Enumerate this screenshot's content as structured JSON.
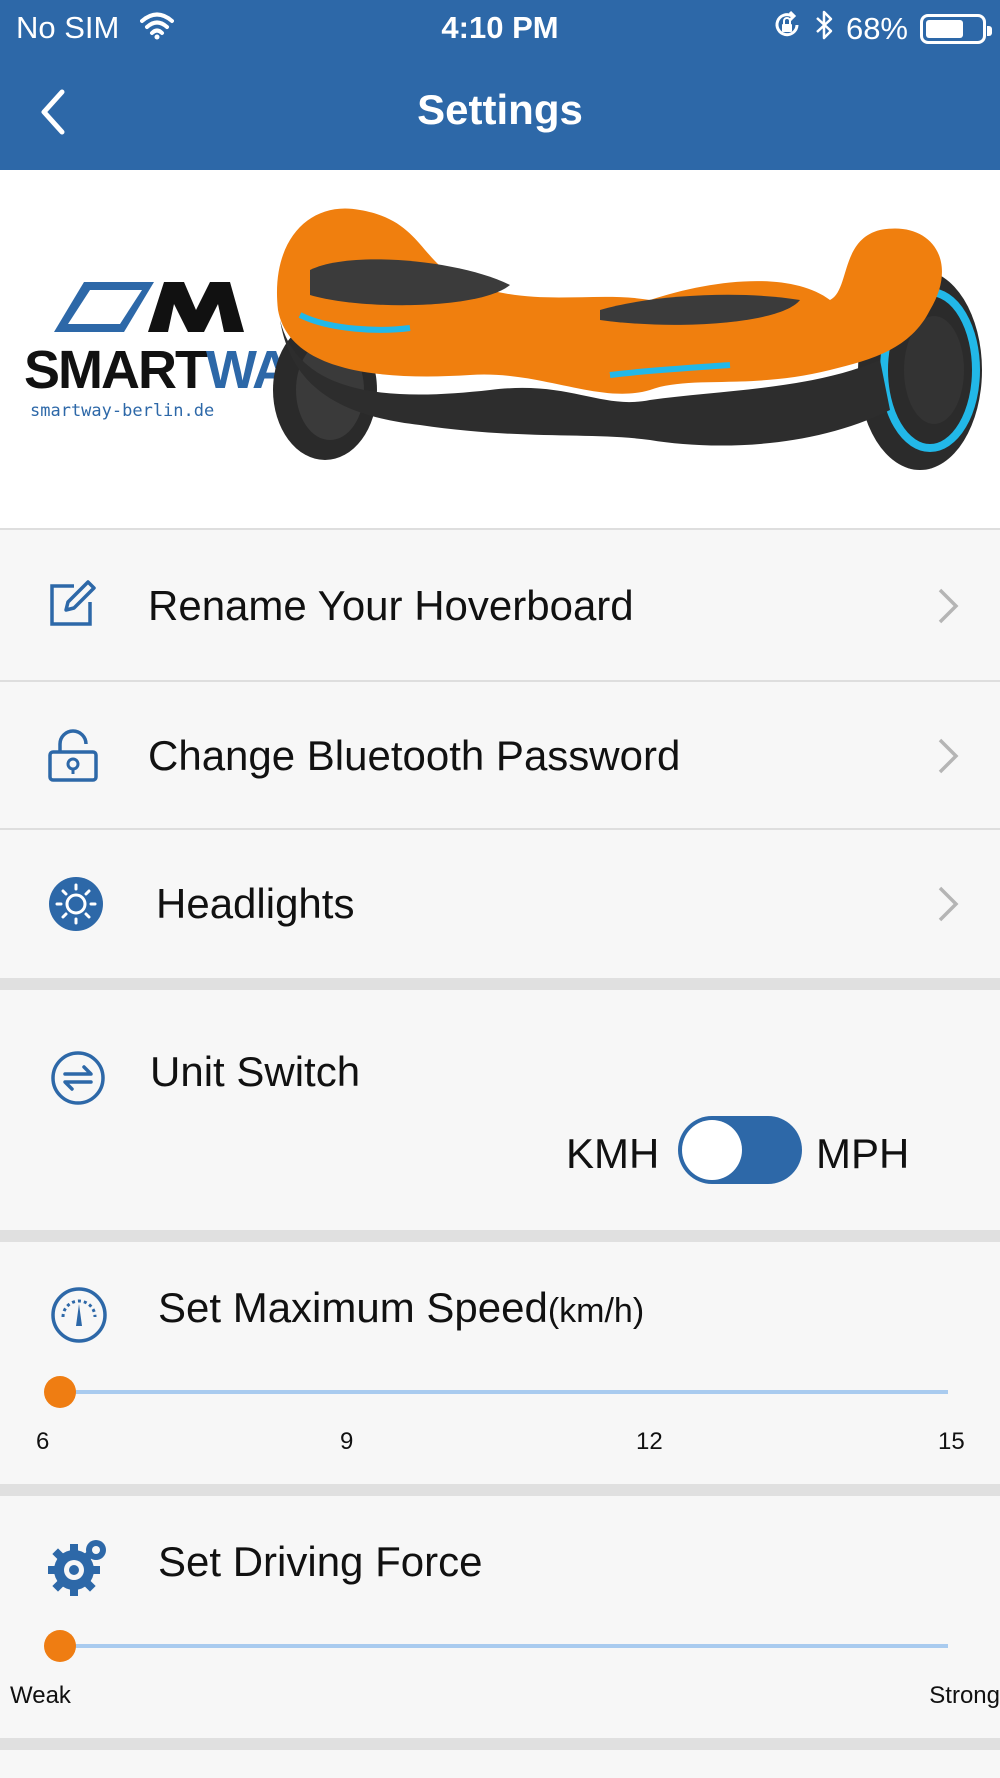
{
  "status_bar": {
    "carrier": "No SIM",
    "time": "4:10 PM",
    "battery_percent": "68%",
    "battery_level": 0.68,
    "icons": [
      "wifi-icon",
      "orientation-lock-icon",
      "bluetooth-icon",
      "battery-icon"
    ]
  },
  "nav": {
    "title": "Settings",
    "back_icon": "chevron-left-icon"
  },
  "brand": {
    "word_smart": "SMART",
    "word_way": "WAY",
    "url": "smartway-berlin.de"
  },
  "menu": [
    {
      "label": "Rename Your Hoverboard",
      "icon": "edit-icon"
    },
    {
      "label": "Change Bluetooth Password",
      "icon": "lock-icon"
    },
    {
      "label": "Headlights",
      "icon": "sun-icon"
    }
  ],
  "unit_switch": {
    "title": "Unit Switch",
    "left_label": "KMH",
    "right_label": "MPH",
    "icon": "swap-icon"
  },
  "max_speed": {
    "title": "Set Maximum Speed",
    "unit": "(km/h)",
    "ticks": [
      "6",
      "9",
      "12",
      "15"
    ],
    "min": 6,
    "max": 15,
    "value": 6,
    "icon": "speedometer-icon"
  },
  "driving_force": {
    "title": "Set Driving Force",
    "min_label": "Weak",
    "max_label": "Strong",
    "value": 0,
    "icon": "gear-icon"
  },
  "colors": {
    "accent": "#2d68a8",
    "slider_thumb": "#ef7d12",
    "slider_track": "#a9cbef",
    "board": "#f07f0e"
  }
}
